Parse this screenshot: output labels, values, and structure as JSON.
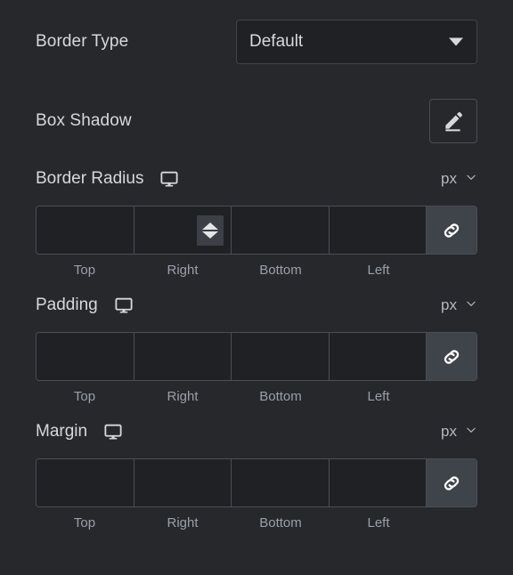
{
  "panel": {
    "border_type": {
      "label": "Border Type",
      "selected": "Default",
      "caret_icon": "chevron-down-icon"
    },
    "box_shadow": {
      "label": "Box Shadow",
      "edit_icon": "pencil-edit-icon"
    },
    "dimension_groups": [
      {
        "key": "border-radius",
        "label": "Border Radius",
        "device_icon": "desktop-monitor-icon",
        "unit": "px",
        "unit_caret_icon": "chevron-down-icon",
        "link_icon": "link-chain-icon",
        "linked": true,
        "fields": [
          {
            "side": "top",
            "label": "Top",
            "value": "",
            "placeholder": ""
          },
          {
            "side": "right",
            "label": "Right",
            "value": "",
            "placeholder": "",
            "spinner_visible": true
          },
          {
            "side": "bottom",
            "label": "Bottom",
            "value": "",
            "placeholder": ""
          },
          {
            "side": "left",
            "label": "Left",
            "value": "",
            "placeholder": ""
          }
        ]
      },
      {
        "key": "padding",
        "label": "Padding",
        "device_icon": "desktop-monitor-icon",
        "unit": "px",
        "unit_caret_icon": "chevron-down-icon",
        "link_icon": "link-chain-icon",
        "linked": true,
        "fields": [
          {
            "side": "top",
            "label": "Top",
            "value": "",
            "placeholder": ""
          },
          {
            "side": "right",
            "label": "Right",
            "value": "",
            "placeholder": ""
          },
          {
            "side": "bottom",
            "label": "Bottom",
            "value": "",
            "placeholder": ""
          },
          {
            "side": "left",
            "label": "Left",
            "value": "",
            "placeholder": ""
          }
        ]
      },
      {
        "key": "margin",
        "label": "Margin",
        "device_icon": "desktop-monitor-icon",
        "unit": "px",
        "unit_caret_icon": "chevron-down-icon",
        "link_icon": "link-chain-icon",
        "linked": true,
        "fields": [
          {
            "side": "top",
            "label": "Top",
            "value": "",
            "placeholder": ""
          },
          {
            "side": "right",
            "label": "Right",
            "value": "",
            "placeholder": ""
          },
          {
            "side": "bottom",
            "label": "Bottom",
            "value": "",
            "placeholder": ""
          },
          {
            "side": "left",
            "label": "Left",
            "value": "",
            "placeholder": ""
          }
        ]
      }
    ]
  },
  "colors": {
    "background": "#26282c",
    "field_background": "#1f2124",
    "border": "#4a4f57",
    "text": "#d5d8dc",
    "muted_text": "#9aa0a8",
    "link_button_background": "#3f444b",
    "spinner_background": "#3c4046"
  }
}
